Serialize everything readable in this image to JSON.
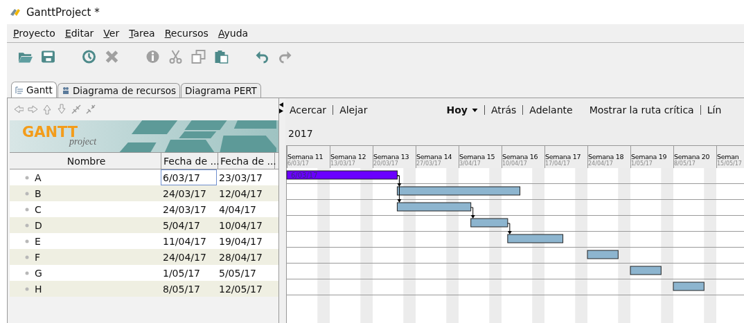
{
  "window": {
    "title": "GanttProject *"
  },
  "menu": [
    {
      "label": "Proyecto"
    },
    {
      "label": "Editar"
    },
    {
      "label": "Ver"
    },
    {
      "label": "Tarea"
    },
    {
      "label": "Recursos"
    },
    {
      "label": "Ayuda"
    }
  ],
  "tabs": [
    {
      "label": "Gantt",
      "selected": true
    },
    {
      "label": "Diagrama de recursos",
      "selected": false
    },
    {
      "label": "Diagrama PERT",
      "selected": false
    }
  ],
  "logo": {
    "big": "GANTT",
    "small": "project"
  },
  "table": {
    "columns": [
      "Nombre",
      "Fecha de ...",
      "Fecha de ..."
    ],
    "rows": [
      {
        "name": "A",
        "start": "6/03/17",
        "end": "23/03/17",
        "selected": true,
        "bar_label": "6/03/17"
      },
      {
        "name": "B",
        "start": "24/03/17",
        "end": "12/04/17",
        "selected": false
      },
      {
        "name": "C",
        "start": "24/03/17",
        "end": "4/04/17",
        "selected": false
      },
      {
        "name": "D",
        "start": "5/04/17",
        "end": "10/04/17",
        "selected": false
      },
      {
        "name": "E",
        "start": "11/04/17",
        "end": "19/04/17",
        "selected": false
      },
      {
        "name": "F",
        "start": "24/04/17",
        "end": "28/04/17",
        "selected": false
      },
      {
        "name": "G",
        "start": "1/05/17",
        "end": "5/05/17",
        "selected": false
      },
      {
        "name": "H",
        "start": "8/05/17",
        "end": "12/05/17",
        "selected": false
      }
    ]
  },
  "chart_toolbar": {
    "zoom_in": "Acercar",
    "zoom_out": "Alejar",
    "today": "Hoy",
    "back": "Atrás",
    "forward": "Adelante",
    "critical_path": "Mostrar la ruta crítica",
    "cut_off": "Lín"
  },
  "timeline": {
    "year": "2017",
    "weeks": [
      {
        "label": "Semana 11",
        "date": "6/03/17"
      },
      {
        "label": "Semana 12",
        "date": "13/03/17"
      },
      {
        "label": "Semana 13",
        "date": "20/03/17"
      },
      {
        "label": "Semana 14",
        "date": "27/03/17"
      },
      {
        "label": "Semana 15",
        "date": "3/04/17"
      },
      {
        "label": "Semana 16",
        "date": "10/04/17"
      },
      {
        "label": "Semana 17",
        "date": "17/04/17"
      },
      {
        "label": "Semana 18",
        "date": "24/04/17"
      },
      {
        "label": "Semana 19",
        "date": "1/05/17"
      },
      {
        "label": "Semana 20",
        "date": "8/05/17"
      },
      {
        "label": "Seman",
        "date": "15/05/17"
      }
    ]
  }
}
